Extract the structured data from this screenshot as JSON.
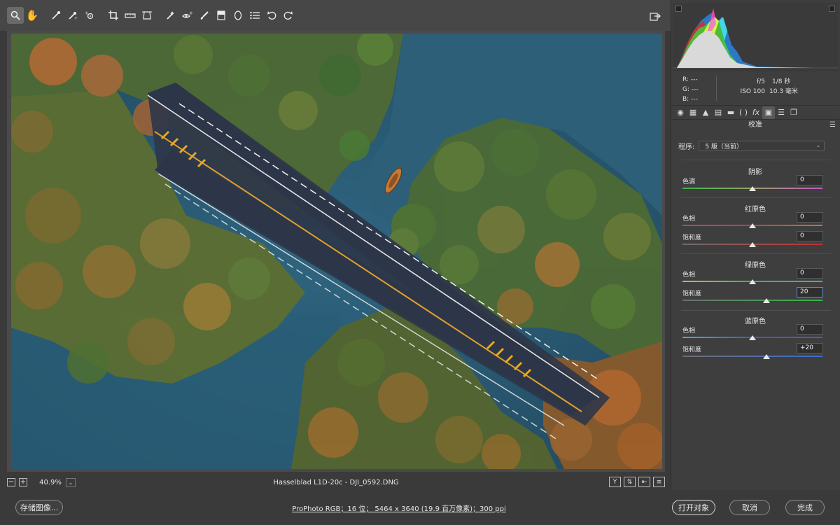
{
  "toolbar": {
    "tools": [
      "zoom-tool",
      "hand-tool",
      "white-balance-tool",
      "color-sampler-tool",
      "target-adjustment-tool",
      "crop-tool",
      "straighten-tool",
      "transform-tool",
      "spot-removal-tool",
      "red-eye-tool",
      "adjustment-brush-tool",
      "graduated-filter-tool",
      "radial-filter-tool",
      "preferences-tool",
      "rotate-left-tool",
      "rotate-right-tool"
    ],
    "fullscreen_icon": "export-icon"
  },
  "status": {
    "zoom": "40.9%",
    "filename": "Hasselblad L1D-20c -  DJI_0592.DNG"
  },
  "footer": {
    "save_label": "存储图像...",
    "workflow_text": "ProPhoto RGB；16 位；  5464 x 3640 (19.9 百万像素)；300 ppi",
    "open_label": "打开对象",
    "cancel_label": "取消",
    "done_label": "完成"
  },
  "readout": {
    "r": "R:   ---",
    "g": "G:   ---",
    "b": "B:   ---",
    "aperture": "f/5",
    "shutter": "1/8 秒",
    "iso": "ISO 100",
    "focal": "10.3 毫米"
  },
  "panel": {
    "title": "校准",
    "process_label": "程序:",
    "process_value": "5 版（当前）",
    "shadows": {
      "head": "阴影",
      "tint_label": "色调",
      "tint_value": "0",
      "tint_level": 0.5
    },
    "red": {
      "head": "红原色",
      "hue_label": "色相",
      "hue_value": "0",
      "hue_level": 0.5,
      "sat_label": "饱和度",
      "sat_value": "0",
      "sat_level": 0.5
    },
    "green": {
      "head": "绿原色",
      "hue_label": "色相",
      "hue_value": "0",
      "hue_level": 0.5,
      "sat_label": "饱和度",
      "sat_value": "20",
      "sat_level": 0.6
    },
    "blue": {
      "head": "蓝原色",
      "hue_label": "色相",
      "hue_value": "0",
      "hue_level": 0.5,
      "sat_label": "饱和度",
      "sat_value": "+20",
      "sat_level": 0.6
    }
  },
  "colors": {
    "accent_focus": "#5a8de0",
    "water": "#2d5b76",
    "road": "#2b3344"
  }
}
